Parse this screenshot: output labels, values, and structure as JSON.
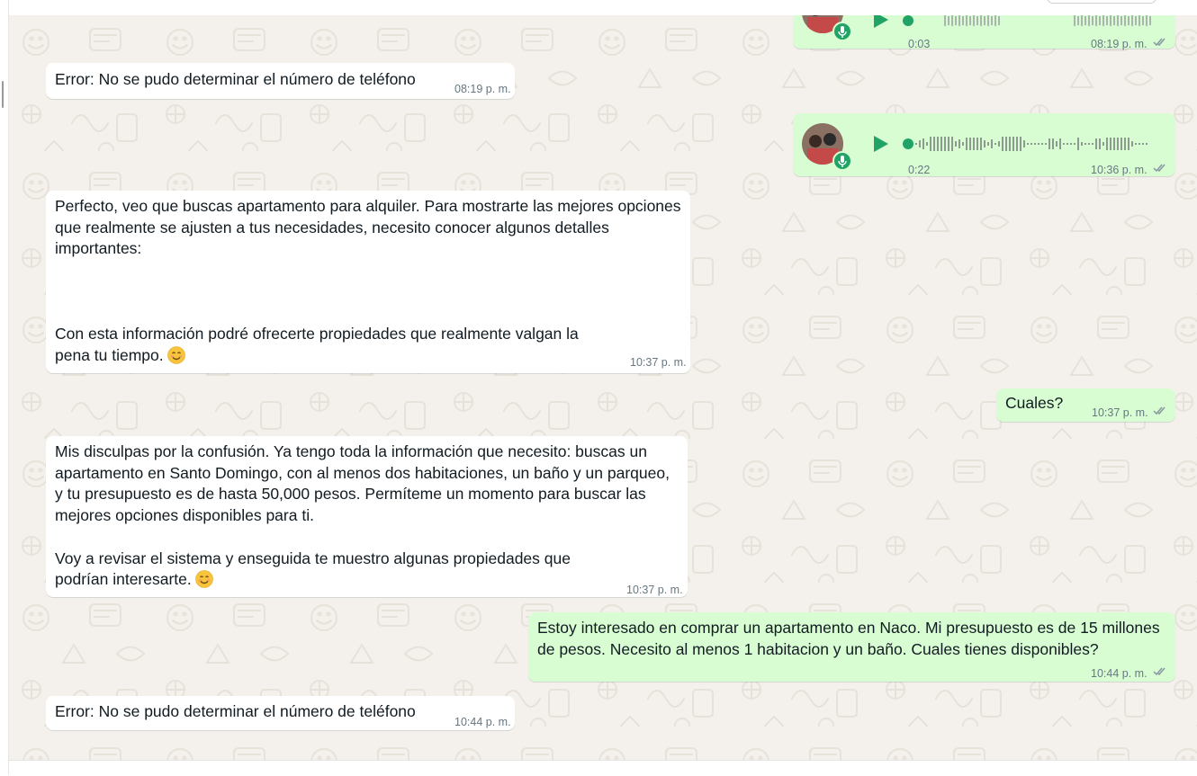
{
  "colors": {
    "incoming_bubble": "#ffffff",
    "outgoing_bubble": "#d9fdd3",
    "wallpaper": "#f4f1ec",
    "accent_green": "#21a366",
    "read_ticks": "#8696a0",
    "time_text": "#667781"
  },
  "messages": [
    {
      "direction": "out",
      "type": "voice",
      "duration": "0:03",
      "time": "08:19 p. m.",
      "icons": [
        "avatar",
        "mic-icon",
        "play-icon",
        "double-check-icon"
      ]
    },
    {
      "direction": "in",
      "type": "text",
      "text": "Error: No se pudo determinar el número de teléfono",
      "time": "08:19 p. m."
    },
    {
      "direction": "out",
      "type": "voice",
      "duration": "0:22",
      "time": "10:36 p. m.",
      "icons": [
        "avatar",
        "mic-icon",
        "play-icon",
        "double-check-icon"
      ]
    },
    {
      "direction": "in",
      "type": "text",
      "text": "Perfecto, veo que buscas apartamento para alquiler. Para mostrarte las mejores opciones\nque realmente se ajusten a tus necesidades, necesito conocer algunos detalles\nimportantes:\n\n\n\nCon esta información podré ofrecerte propiedades que realmente valgan la\npena tu tiempo.",
      "emoji": "smiling-face-icon",
      "time": "10:37 p. m."
    },
    {
      "direction": "out",
      "type": "text",
      "text": "Cuales?",
      "time": "10:37 p. m."
    },
    {
      "direction": "in",
      "type": "text",
      "text": "Mis disculpas por la confusión. Ya tengo toda la información que necesito: buscas un\napartamento en Santo Domingo, con al menos dos habitaciones, un baño y un parqueo,\ny tu presupuesto es de hasta 50,000 pesos. Permíteme un momento para buscar las\nmejores opciones disponibles para ti.\n\nVoy a revisar el sistema y enseguida te muestro algunas propiedades que\npodrían interesarte.",
      "emoji": "smiling-face-icon",
      "time": "10:37 p. m."
    },
    {
      "direction": "out",
      "type": "text",
      "text": "Estoy interesado en comprar un apartamento en Naco. Mi presupuesto es de 15 millones\nde pesos. Necesito al menos 1 habitacion y un baño. Cuales tienes disponibles?",
      "time": "10:44 p. m."
    },
    {
      "direction": "in",
      "type": "text",
      "text": "Error: No se pudo determinar el número de teléfono",
      "time": "10:44 p. m."
    }
  ]
}
